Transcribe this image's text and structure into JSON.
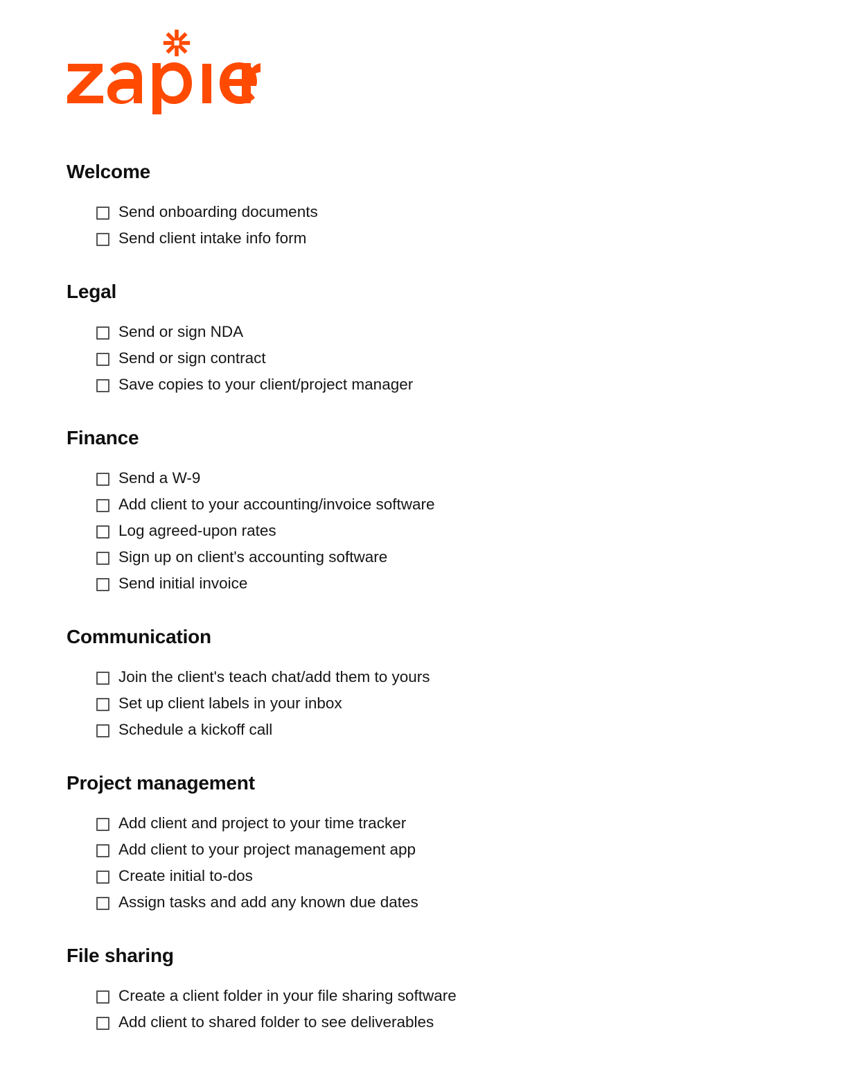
{
  "brand": {
    "name": "zapier",
    "logo_wordmark_text": "zapier",
    "logo_mark_icon": "zapier-asterisk-icon",
    "accent_color": "#FF4A00"
  },
  "document": {
    "background_color": "#FFFFFF",
    "heading_color": "#0F0F0F",
    "text_color": "#161616",
    "checkbox_border_color": "#545454"
  },
  "sections": [
    {
      "heading": "Welcome",
      "items": [
        {
          "label": "Send onboarding documents",
          "checked": false
        },
        {
          "label": "Send client intake info form",
          "checked": false
        }
      ]
    },
    {
      "heading": "Legal",
      "items": [
        {
          "label": "Send or sign NDA",
          "checked": false
        },
        {
          "label": "Send or sign contract",
          "checked": false
        },
        {
          "label": "Save copies to your client/project manager",
          "checked": false
        }
      ]
    },
    {
      "heading": "Finance",
      "items": [
        {
          "label": "Send a W-9",
          "checked": false
        },
        {
          "label": "Add client to your accounting/invoice software",
          "checked": false
        },
        {
          "label": "Log agreed-upon rates",
          "checked": false
        },
        {
          "label": "Sign up on client's accounting software",
          "checked": false
        },
        {
          "label": "Send initial invoice",
          "checked": false
        }
      ]
    },
    {
      "heading": "Communication",
      "items": [
        {
          "label": "Join the client's teach chat/add them to yours",
          "checked": false
        },
        {
          "label": "Set up client labels in your inbox",
          "checked": false
        },
        {
          "label": "Schedule a kickoff call",
          "checked": false
        }
      ]
    },
    {
      "heading": "Project management",
      "items": [
        {
          "label": "Add client and project to your time tracker",
          "checked": false
        },
        {
          "label": "Add client to your project management app",
          "checked": false
        },
        {
          "label": "Create initial to-dos",
          "checked": false
        },
        {
          "label": "Assign tasks and add any known due dates",
          "checked": false
        }
      ]
    },
    {
      "heading": "File sharing",
      "items": [
        {
          "label": "Create a client folder in your file sharing software",
          "checked": false
        },
        {
          "label": "Add client to shared folder to see deliverables",
          "checked": false
        }
      ]
    }
  ]
}
